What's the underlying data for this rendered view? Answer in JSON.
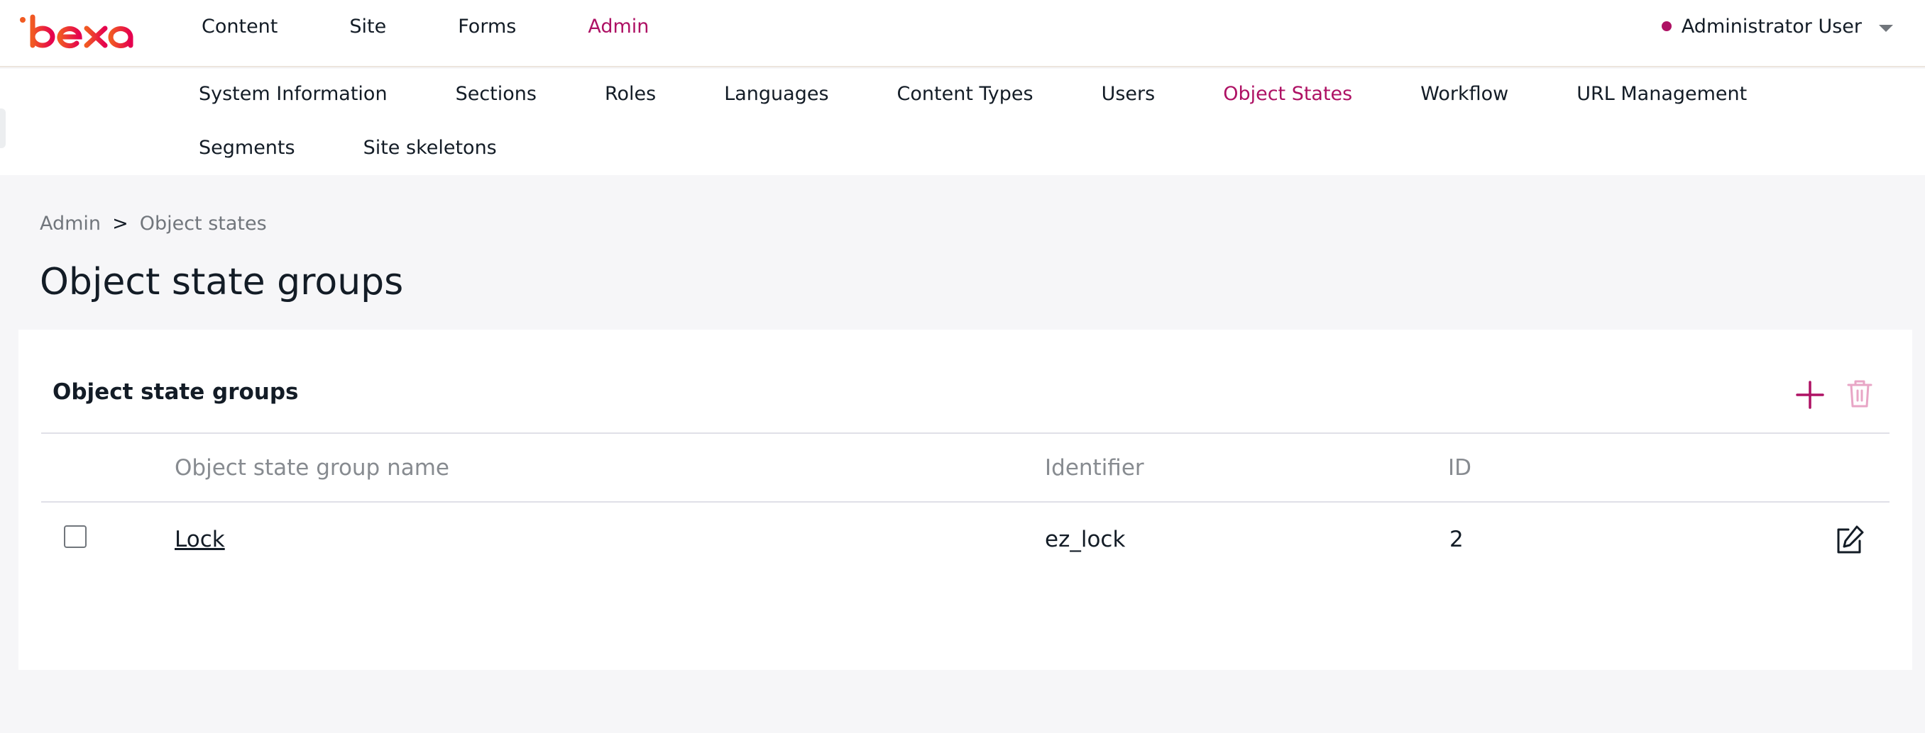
{
  "brand": {
    "logo_text": "ibexa",
    "accent": "#ae1164",
    "logo_colors": [
      "#f15a22",
      "#e5004f"
    ]
  },
  "topnav": {
    "items": [
      "Content",
      "Site",
      "Forms",
      "Admin"
    ],
    "active": "Admin"
  },
  "user": {
    "name": "Administrator User"
  },
  "subnav": {
    "row1": [
      "System Information",
      "Sections",
      "Roles",
      "Languages",
      "Content Types",
      "Users",
      "Object States",
      "Workflow",
      "URL Management"
    ],
    "row2": [
      "Segments",
      "Site skeletons"
    ],
    "active": "Object States"
  },
  "breadcrumb": {
    "items": [
      "Admin",
      "Object states"
    ],
    "separator": ">"
  },
  "page": {
    "title": "Object state groups"
  },
  "panel": {
    "title": "Object state groups",
    "actions": {
      "add_icon": "plus-icon",
      "delete_icon": "trash-icon"
    },
    "columns": [
      "Object state group name",
      "Identifier",
      "ID"
    ],
    "rows": [
      {
        "name": "Lock",
        "identifier": "ez_lock",
        "id": "2",
        "checked": false
      }
    ]
  }
}
